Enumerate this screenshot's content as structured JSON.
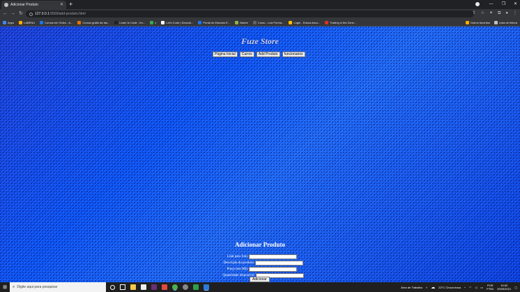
{
  "browser": {
    "tab_title": "Adicionar Produto",
    "new_tab_symbol": "+",
    "url_host": "127.0.0.1",
    "url_path": ":5500/add-produto.html",
    "bookmarks": [
      {
        "label": "Apps",
        "color": "#4285f4"
      },
      {
        "label": "LABENU",
        "color": "#f9ab00"
      },
      {
        "label": "Cursos em Vídeo - A...",
        "color": "#1a73e8"
      },
      {
        "label": "Cursos grátis da Ias...",
        "color": "#e37400"
      },
      {
        "label": "Learn to Code - fro...",
        "color": "#202124"
      },
      {
        "label": "x",
        "color": "#34a853"
      },
      {
        "label": "Let's Code | Descub...",
        "color": "#ffffff"
      },
      {
        "label": "Portal do Estudos E...",
        "color": "#1a73e8"
      },
      {
        "label": "Nubee",
        "color": "#8ab34a"
      },
      {
        "label": "Curso - Low Forma...",
        "color": "#5f6368"
      },
      {
        "label": "Login - Educa Ascu...",
        "color": "#fbbc04"
      },
      {
        "label": "Trading in the Zone...",
        "color": "#d93025"
      }
    ],
    "bookmarks_right": [
      "Outros favoritos",
      "Lista de leitura"
    ]
  },
  "page": {
    "store_title": "Fuze Store",
    "nav": [
      "Página Inicial",
      "Carros",
      "Add Produto",
      "funcionarios"
    ],
    "form_title": "Adicionar Produto",
    "fields": [
      {
        "label": "Link para foto:"
      },
      {
        "label": "Descrição do produto:"
      },
      {
        "label": "Preço (em R$):"
      },
      {
        "label": "Quantidade disponível:"
      }
    ],
    "submit_label": "Adicionar"
  },
  "taskbar": {
    "search_placeholder": "Digite aqui para pesquisar",
    "desktop_label": "Área de Trabalho",
    "weather": "22°C  Chuva fraca",
    "language": "POR",
    "layout": "PTB2",
    "time": "19:00",
    "date": "29/09/2021"
  }
}
